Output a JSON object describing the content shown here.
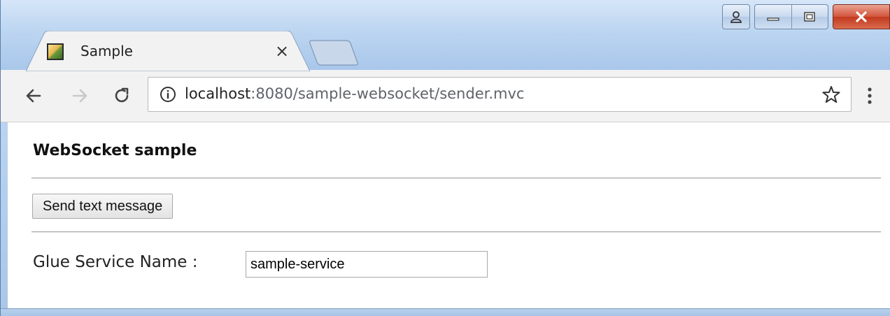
{
  "browser": {
    "tab": {
      "title": "Sample",
      "close_label": "×"
    },
    "address": {
      "host": "localhost",
      "rest": ":8080/sample-websocket/sender.mvc"
    }
  },
  "page": {
    "title": "WebSocket sample",
    "send_button_label": "Send text message",
    "service_label": "Glue Service Name :",
    "service_value": "sample-service"
  }
}
